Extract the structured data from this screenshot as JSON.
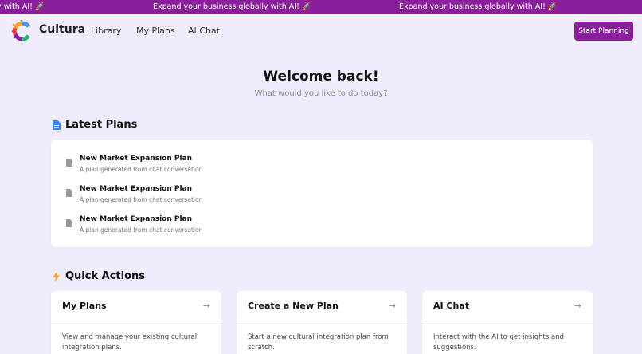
{
  "banner": {
    "items": [
      "y with AI! 🚀",
      "Expand your business globally with AI! 🚀",
      "Expand your business globally with AI! 🚀"
    ],
    "background": "#8a1f9c"
  },
  "navbar": {
    "brand": "Cultura",
    "links": [
      "Library",
      "My Plans",
      "AI Chat"
    ],
    "cta_label": "Start Planning"
  },
  "welcome": {
    "title": "Welcome back!",
    "subtitle": "What would you like to do today?"
  },
  "latest_plans": {
    "title": "Latest Plans",
    "icon": "document-icon",
    "items": [
      {
        "name": "New Market Expansion Plan",
        "description": "A plan generated from chat conversation"
      },
      {
        "name": "New Market Expansion Plan",
        "description": "A plan generated from chat conversation"
      },
      {
        "name": "New Market Expansion Plan",
        "description": "A plan generated from chat conversation"
      }
    ]
  },
  "quick_actions": {
    "title": "Quick Actions",
    "icon": "lightning-icon",
    "cards": [
      {
        "title": "My Plans",
        "description": "View and manage your existing cultural integration plans."
      },
      {
        "title": "Create a New Plan",
        "description": "Start a new cultural integration plan from scratch."
      },
      {
        "title": "AI Chat",
        "description": "Interact with the AI to get insights and suggestions."
      }
    ]
  },
  "colors": {
    "accent": "#8a1f9c",
    "page_background": "#f1ecfb",
    "card_background": "#ffffff"
  }
}
